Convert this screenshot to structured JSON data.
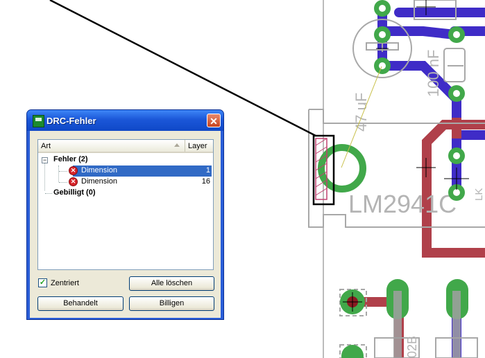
{
  "pcb": {
    "labels": {
      "cap_value": "47 uF",
      "cap_value2": "100 nF",
      "regulator": "LM2941C",
      "regulator_short": "LK",
      "bottom_part": "02B"
    },
    "colors": {
      "trace_blue": "#3f2cc7",
      "trace_red": "#b0404a",
      "pad_green": "#41a84a",
      "outline_gray": "#a8a8a8"
    }
  },
  "dialog": {
    "title": "DRC-Fehler",
    "close_label": "✕",
    "columns": {
      "art": "Art",
      "layer": "Layer"
    },
    "tree": {
      "fehler_label": "Fehler (2)",
      "errors": [
        {
          "label": "Dimension",
          "layer": "1",
          "selected": true
        },
        {
          "label": "Dimension",
          "layer": "16",
          "selected": false
        }
      ],
      "gebilligt_label": "Gebilligt (0)"
    },
    "zentriert": {
      "label": "Zentriert",
      "checked": true
    },
    "buttons": {
      "alle_loeschen": "Alle löschen",
      "behandelt": "Behandelt",
      "billigen": "Billigen"
    }
  }
}
